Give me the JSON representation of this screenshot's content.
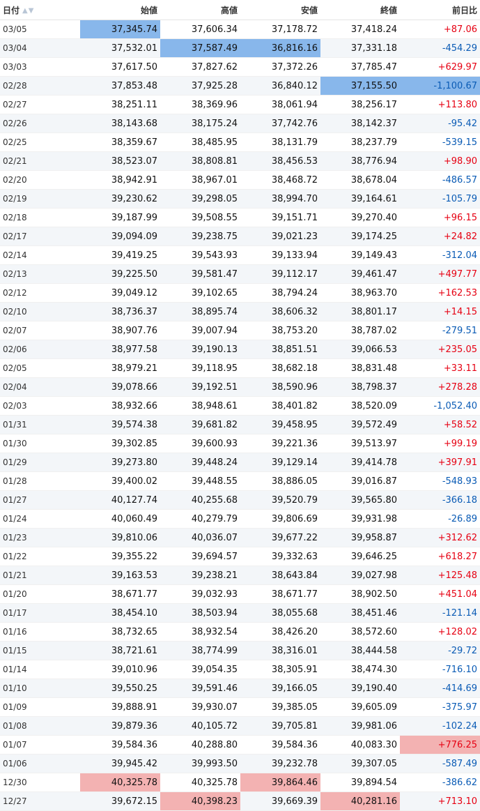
{
  "headers": {
    "date": "日付",
    "open": "始値",
    "high": "高値",
    "low": "安値",
    "close": "終値",
    "change": "前日比"
  },
  "sort_icon": "sort-arrows-icon",
  "colors": {
    "positive": "#e60012",
    "negative": "#0a5bb5",
    "highlight_max": "#88b7eb",
    "highlight_min": "#f3b2b2"
  },
  "rows": [
    {
      "date": "03/05",
      "open": "37,345.74",
      "high": "37,606.34",
      "low": "37,178.72",
      "close": "37,418.24",
      "change": "+87.06",
      "dir": "pos",
      "hl": {
        "open": "blue"
      }
    },
    {
      "date": "03/04",
      "open": "37,532.01",
      "high": "37,587.49",
      "low": "36,816.16",
      "close": "37,331.18",
      "change": "-454.29",
      "dir": "neg",
      "hl": {
        "high": "blue",
        "low": "blue"
      }
    },
    {
      "date": "03/03",
      "open": "37,617.50",
      "high": "37,827.62",
      "low": "37,372.26",
      "close": "37,785.47",
      "change": "+629.97",
      "dir": "pos",
      "hl": {}
    },
    {
      "date": "02/28",
      "open": "37,853.48",
      "high": "37,925.28",
      "low": "36,840.12",
      "close": "37,155.50",
      "change": "-1,100.67",
      "dir": "neg",
      "hl": {
        "close": "blue",
        "change": "blue"
      }
    },
    {
      "date": "02/27",
      "open": "38,251.11",
      "high": "38,369.96",
      "low": "38,061.94",
      "close": "38,256.17",
      "change": "+113.80",
      "dir": "pos",
      "hl": {}
    },
    {
      "date": "02/26",
      "open": "38,143.68",
      "high": "38,175.24",
      "low": "37,742.76",
      "close": "38,142.37",
      "change": "-95.42",
      "dir": "neg",
      "hl": {}
    },
    {
      "date": "02/25",
      "open": "38,359.67",
      "high": "38,485.95",
      "low": "38,131.79",
      "close": "38,237.79",
      "change": "-539.15",
      "dir": "neg",
      "hl": {}
    },
    {
      "date": "02/21",
      "open": "38,523.07",
      "high": "38,808.81",
      "low": "38,456.53",
      "close": "38,776.94",
      "change": "+98.90",
      "dir": "pos",
      "hl": {}
    },
    {
      "date": "02/20",
      "open": "38,942.91",
      "high": "38,967.01",
      "low": "38,468.72",
      "close": "38,678.04",
      "change": "-486.57",
      "dir": "neg",
      "hl": {}
    },
    {
      "date": "02/19",
      "open": "39,230.62",
      "high": "39,298.05",
      "low": "38,994.70",
      "close": "39,164.61",
      "change": "-105.79",
      "dir": "neg",
      "hl": {}
    },
    {
      "date": "02/18",
      "open": "39,187.99",
      "high": "39,508.55",
      "low": "39,151.71",
      "close": "39,270.40",
      "change": "+96.15",
      "dir": "pos",
      "hl": {}
    },
    {
      "date": "02/17",
      "open": "39,094.09",
      "high": "39,238.75",
      "low": "39,021.23",
      "close": "39,174.25",
      "change": "+24.82",
      "dir": "pos",
      "hl": {}
    },
    {
      "date": "02/14",
      "open": "39,419.25",
      "high": "39,543.93",
      "low": "39,133.94",
      "close": "39,149.43",
      "change": "-312.04",
      "dir": "neg",
      "hl": {}
    },
    {
      "date": "02/13",
      "open": "39,225.50",
      "high": "39,581.47",
      "low": "39,112.17",
      "close": "39,461.47",
      "change": "+497.77",
      "dir": "pos",
      "hl": {}
    },
    {
      "date": "02/12",
      "open": "39,049.12",
      "high": "39,102.65",
      "low": "38,794.24",
      "close": "38,963.70",
      "change": "+162.53",
      "dir": "pos",
      "hl": {}
    },
    {
      "date": "02/10",
      "open": "38,736.37",
      "high": "38,895.74",
      "low": "38,606.32",
      "close": "38,801.17",
      "change": "+14.15",
      "dir": "pos",
      "hl": {}
    },
    {
      "date": "02/07",
      "open": "38,907.76",
      "high": "39,007.94",
      "low": "38,753.20",
      "close": "38,787.02",
      "change": "-279.51",
      "dir": "neg",
      "hl": {}
    },
    {
      "date": "02/06",
      "open": "38,977.58",
      "high": "39,190.13",
      "low": "38,851.51",
      "close": "39,066.53",
      "change": "+235.05",
      "dir": "pos",
      "hl": {}
    },
    {
      "date": "02/05",
      "open": "38,979.21",
      "high": "39,118.95",
      "low": "38,682.18",
      "close": "38,831.48",
      "change": "+33.11",
      "dir": "pos",
      "hl": {}
    },
    {
      "date": "02/04",
      "open": "39,078.66",
      "high": "39,192.51",
      "low": "38,590.96",
      "close": "38,798.37",
      "change": "+278.28",
      "dir": "pos",
      "hl": {}
    },
    {
      "date": "02/03",
      "open": "38,932.66",
      "high": "38,948.61",
      "low": "38,401.82",
      "close": "38,520.09",
      "change": "-1,052.40",
      "dir": "neg",
      "hl": {}
    },
    {
      "date": "01/31",
      "open": "39,574.38",
      "high": "39,681.82",
      "low": "39,458.95",
      "close": "39,572.49",
      "change": "+58.52",
      "dir": "pos",
      "hl": {}
    },
    {
      "date": "01/30",
      "open": "39,302.85",
      "high": "39,600.93",
      "low": "39,221.36",
      "close": "39,513.97",
      "change": "+99.19",
      "dir": "pos",
      "hl": {}
    },
    {
      "date": "01/29",
      "open": "39,273.80",
      "high": "39,448.24",
      "low": "39,129.14",
      "close": "39,414.78",
      "change": "+397.91",
      "dir": "pos",
      "hl": {}
    },
    {
      "date": "01/28",
      "open": "39,400.02",
      "high": "39,448.55",
      "low": "38,886.05",
      "close": "39,016.87",
      "change": "-548.93",
      "dir": "neg",
      "hl": {}
    },
    {
      "date": "01/27",
      "open": "40,127.74",
      "high": "40,255.68",
      "low": "39,520.79",
      "close": "39,565.80",
      "change": "-366.18",
      "dir": "neg",
      "hl": {}
    },
    {
      "date": "01/24",
      "open": "40,060.49",
      "high": "40,279.79",
      "low": "39,806.69",
      "close": "39,931.98",
      "change": "-26.89",
      "dir": "neg",
      "hl": {}
    },
    {
      "date": "01/23",
      "open": "39,810.06",
      "high": "40,036.07",
      "low": "39,677.22",
      "close": "39,958.87",
      "change": "+312.62",
      "dir": "pos",
      "hl": {}
    },
    {
      "date": "01/22",
      "open": "39,355.22",
      "high": "39,694.57",
      "low": "39,332.63",
      "close": "39,646.25",
      "change": "+618.27",
      "dir": "pos",
      "hl": {}
    },
    {
      "date": "01/21",
      "open": "39,163.53",
      "high": "39,238.21",
      "low": "38,643.84",
      "close": "39,027.98",
      "change": "+125.48",
      "dir": "pos",
      "hl": {}
    },
    {
      "date": "01/20",
      "open": "38,671.77",
      "high": "39,032.93",
      "low": "38,671.77",
      "close": "38,902.50",
      "change": "+451.04",
      "dir": "pos",
      "hl": {}
    },
    {
      "date": "01/17",
      "open": "38,454.10",
      "high": "38,503.94",
      "low": "38,055.68",
      "close": "38,451.46",
      "change": "-121.14",
      "dir": "neg",
      "hl": {}
    },
    {
      "date": "01/16",
      "open": "38,732.65",
      "high": "38,932.54",
      "low": "38,426.20",
      "close": "38,572.60",
      "change": "+128.02",
      "dir": "pos",
      "hl": {}
    },
    {
      "date": "01/15",
      "open": "38,721.61",
      "high": "38,774.99",
      "low": "38,316.01",
      "close": "38,444.58",
      "change": "-29.72",
      "dir": "neg",
      "hl": {}
    },
    {
      "date": "01/14",
      "open": "39,010.96",
      "high": "39,054.35",
      "low": "38,305.91",
      "close": "38,474.30",
      "change": "-716.10",
      "dir": "neg",
      "hl": {}
    },
    {
      "date": "01/10",
      "open": "39,550.25",
      "high": "39,591.46",
      "low": "39,166.05",
      "close": "39,190.40",
      "change": "-414.69",
      "dir": "neg",
      "hl": {}
    },
    {
      "date": "01/09",
      "open": "39,888.91",
      "high": "39,930.07",
      "low": "39,385.05",
      "close": "39,605.09",
      "change": "-375.97",
      "dir": "neg",
      "hl": {}
    },
    {
      "date": "01/08",
      "open": "39,879.36",
      "high": "40,105.72",
      "low": "39,705.81",
      "close": "39,981.06",
      "change": "-102.24",
      "dir": "neg",
      "hl": {}
    },
    {
      "date": "01/07",
      "open": "39,584.36",
      "high": "40,288.80",
      "low": "39,584.36",
      "close": "40,083.30",
      "change": "+776.25",
      "dir": "pos",
      "hl": {
        "change": "red"
      }
    },
    {
      "date": "01/06",
      "open": "39,945.42",
      "high": "39,993.50",
      "low": "39,232.78",
      "close": "39,307.05",
      "change": "-587.49",
      "dir": "neg",
      "hl": {}
    },
    {
      "date": "12/30",
      "open": "40,325.78",
      "high": "40,325.78",
      "low": "39,864.46",
      "close": "39,894.54",
      "change": "-386.62",
      "dir": "neg",
      "hl": {
        "open": "red",
        "low": "red"
      }
    },
    {
      "date": "12/27",
      "open": "39,672.15",
      "high": "40,398.23",
      "low": "39,669.39",
      "close": "40,281.16",
      "change": "+713.10",
      "dir": "pos",
      "hl": {
        "high": "red",
        "close": "red"
      }
    }
  ]
}
